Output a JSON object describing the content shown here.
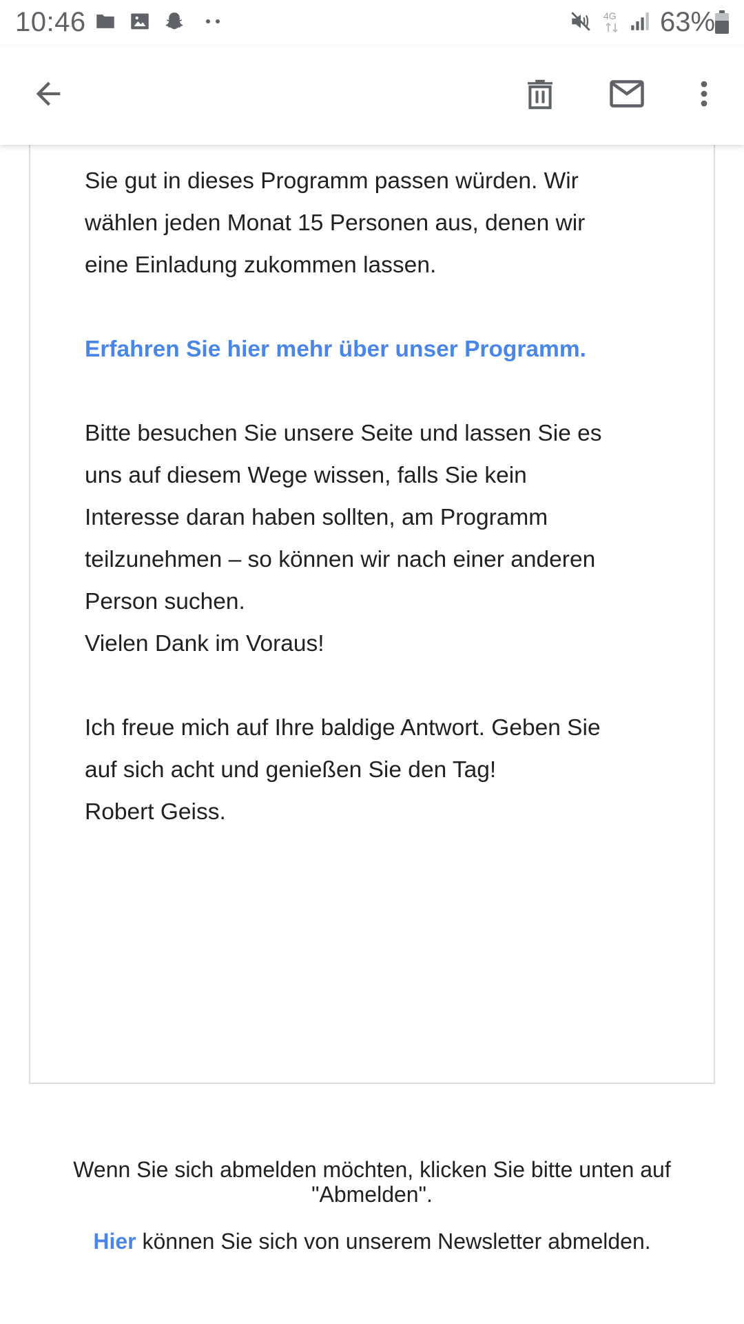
{
  "status_bar": {
    "time": "10:46",
    "battery": "63%",
    "network": "4G",
    "icons": [
      "folder-icon",
      "image-icon",
      "snapchat-icon",
      "more-dots-icon",
      "mute-icon",
      "network-4g-icon",
      "signal-icon",
      "battery-icon"
    ]
  },
  "app_bar": {
    "back_icon": "arrow-back-icon",
    "delete_icon": "trash-icon",
    "mark_unread_icon": "mail-icon",
    "more_icon": "more-vert-icon"
  },
  "email": {
    "paragraph_1": [
      "Sie gut in dieses Programm passen würden. Wir",
      "wählen jeden Monat 15 Personen aus, denen wir",
      "eine Einladung zukommen lassen."
    ],
    "link_text": "Erfahren Sie hier mehr über unser Programm.",
    "paragraph_2": [
      "Bitte besuchen Sie unsere Seite und lassen Sie es",
      "uns auf diesem Wege wissen, falls Sie kein",
      "Interesse daran haben sollten, am Programm",
      "teilzunehmen – so können wir nach einer anderen",
      "Person suchen."
    ],
    "thanks": "Vielen Dank im Voraus!",
    "paragraph_3": [
      "Ich freue mich auf Ihre baldige Antwort. Geben Sie",
      "auf sich acht und genießen Sie den Tag!"
    ],
    "signature": "Robert Geiss."
  },
  "footer": {
    "unsubscribe_line_1": "Wenn Sie sich abmelden möchten, klicken Sie bitte unten auf",
    "unsubscribe_line_2": "\"Abmelden\".",
    "here_link": "Hier",
    "here_rest": " können Sie sich von unserem Newsletter abmelden."
  },
  "colors": {
    "link": "#4a86e8",
    "text": "#202124",
    "icon": "#5f6368",
    "border": "#dadce0"
  }
}
